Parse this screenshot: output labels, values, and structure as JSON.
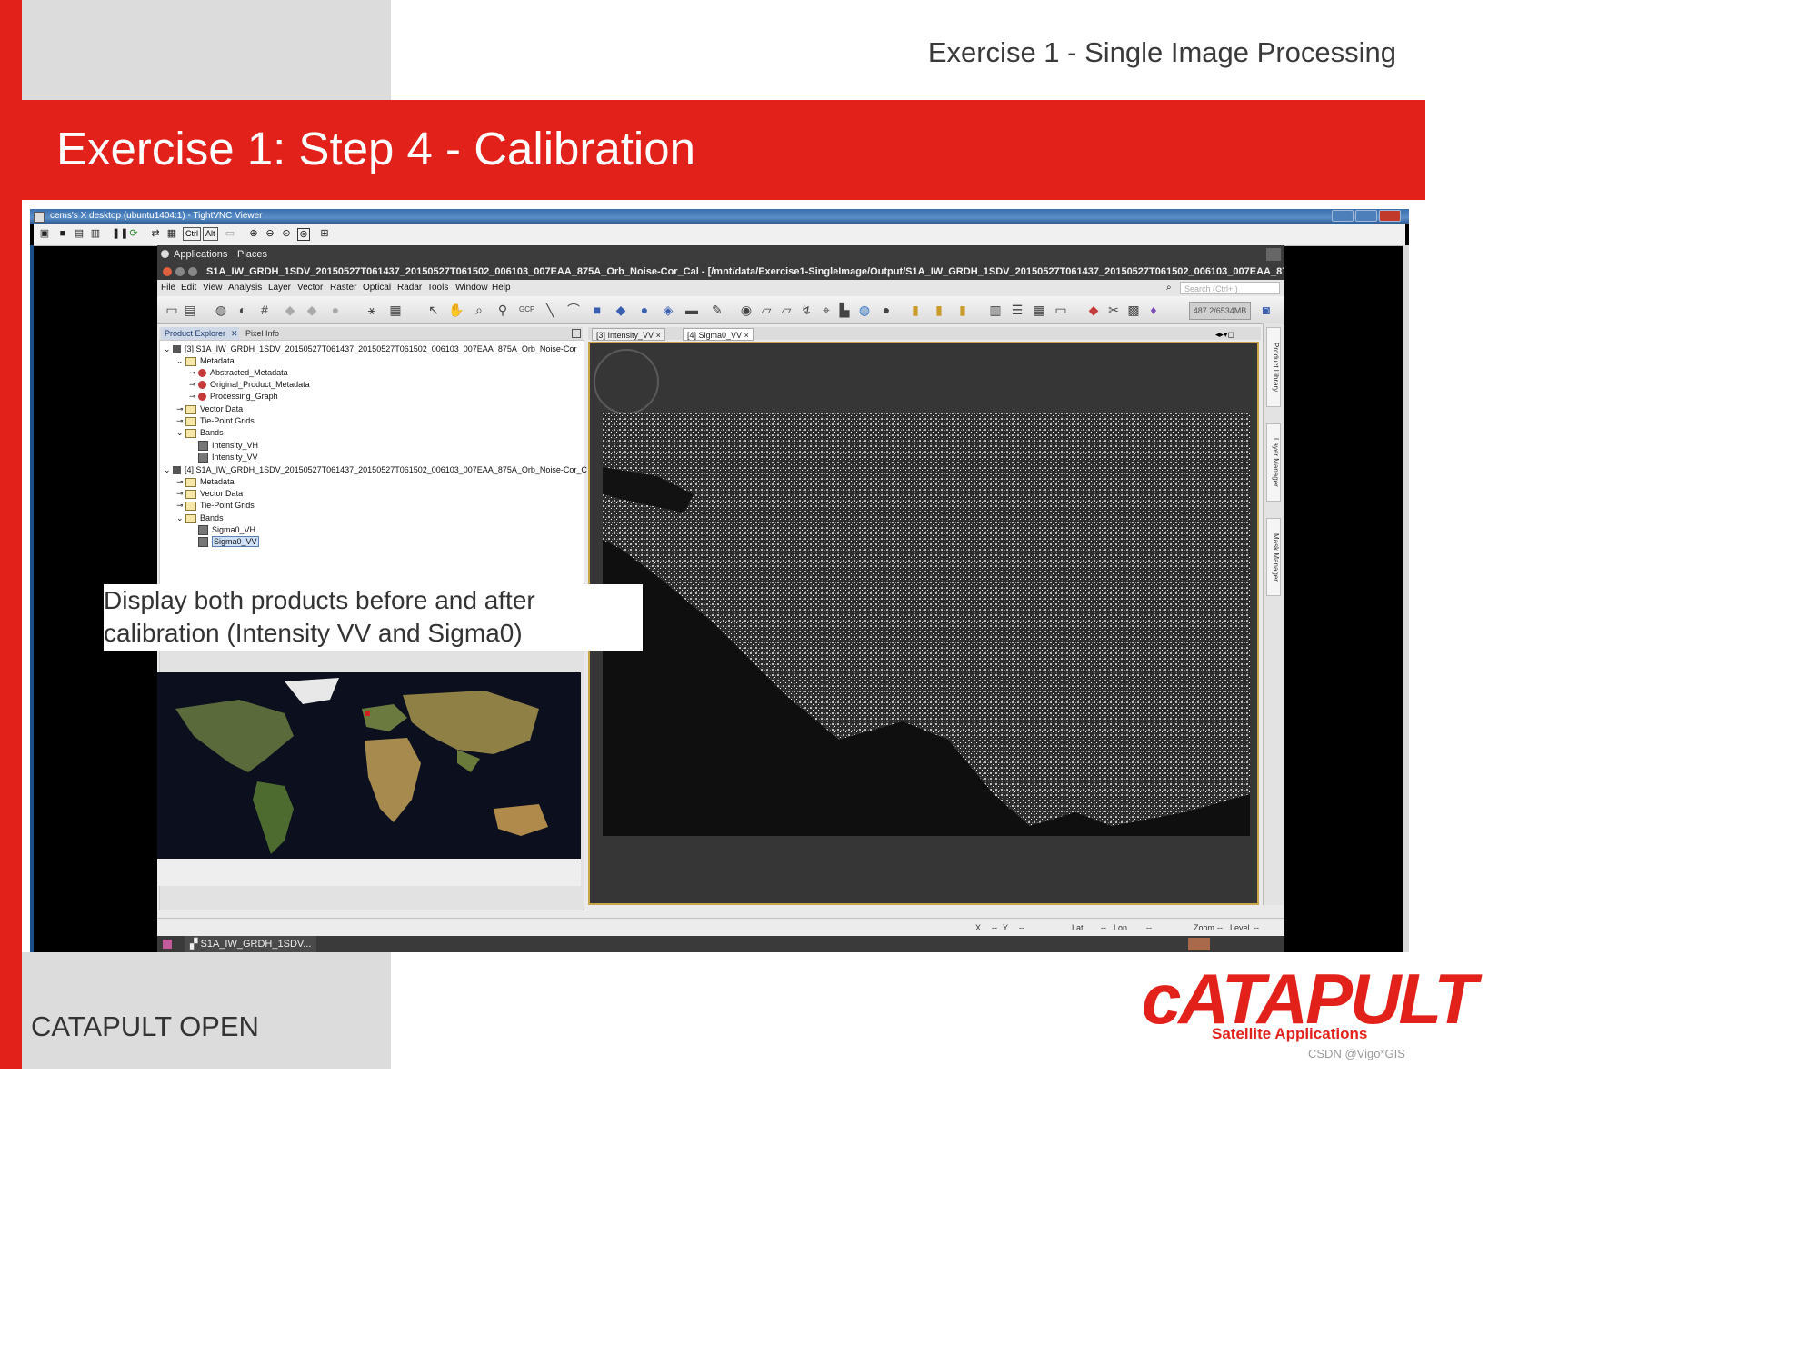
{
  "slide": {
    "header": "Exercise 1 - Single Image Processing",
    "title": "Exercise 1: Step 4 - Calibration",
    "footer": "CATAPULT OPEN",
    "logo_main": "cATAPULT",
    "logo_sub": "Satellite Applications",
    "watermark": "CSDN @Vigo*GIS",
    "callout_line1": "Display both products before and after",
    "callout_line2": "calibration (Intensity VV and Sigma0)"
  },
  "vnc": {
    "title": "cems's X desktop (ubuntu1404:1) - TightVNC Viewer",
    "toolbar_icons": [
      "new-connection-icon",
      "save-icon",
      "options-icon",
      "info-icon",
      "pause-icon",
      "refresh-icon",
      "ctrl-alt-del-icon",
      "clipboard-icon"
    ],
    "ctrl_label": "Ctrl",
    "alt_label": "Alt"
  },
  "gnome": {
    "applications": "Applications",
    "places": "Places"
  },
  "snap": {
    "title": "S1A_IW_GRDH_1SDV_20150527T061437_20150527T061502_006103_007EAA_875A_Orb_Noise-Cor_Cal - [/mnt/data/Exercise1-SingleImage/Output/S1A_IW_GRDH_1SDV_20150527T061437_20150527T061502_006103_007EAA_875",
    "menu": [
      "File",
      "Edit",
      "View",
      "Analysis",
      "Layer",
      "Vector",
      "Raster",
      "Optical",
      "Radar",
      "Tools",
      "Window",
      "Help"
    ],
    "search_placeholder": "Search (Ctrl+I)",
    "memory": "487.2/6534MB",
    "explorer_tabs": [
      "Product Explorer",
      "Pixel Info"
    ],
    "tree": {
      "p3": "[3] S1A_IW_GRDH_1SDV_20150527T061437_20150527T061502_006103_007EAA_875A_Orb_Noise-Cor",
      "metadata": "Metadata",
      "abstracted": "Abstracted_Metadata",
      "original": "Original_Product_Metadata",
      "processing": "Processing_Graph",
      "vector": "Vector Data",
      "tiepoint": "Tie-Point Grids",
      "bands": "Bands",
      "intensity_vh": "Intensity_VH",
      "intensity_vv": "Intensity_VV",
      "p4": "[4] S1A_IW_GRDH_1SDV_20150527T061437_20150527T061502_006103_007EAA_875A_Orb_Noise-Cor_C",
      "sigma_vh": "Sigma0_VH",
      "sigma_vv": "Sigma0_VV"
    },
    "view_tabs": [
      "[3] Intensity_VV",
      "[4] Sigma0_VV"
    ],
    "side_tabs": [
      "Product Library",
      "Layer Manager",
      "Mask Manager"
    ],
    "status": {
      "x": "X",
      "x_val": "--",
      "y": "Y",
      "y_val": "--",
      "lat": "Lat",
      "lat_val": "--",
      "lon": "Lon",
      "lon_val": "--",
      "zoom": "Zoom",
      "zoom_val": "--",
      "level": "Level",
      "level_val": "--"
    },
    "taskbar_item": "S1A_IW_GRDH_1SDV..."
  },
  "colors": {
    "brand_red": "#e3211b",
    "panel_gray": "#dcdcdc",
    "view_border": "#c9a64a"
  }
}
